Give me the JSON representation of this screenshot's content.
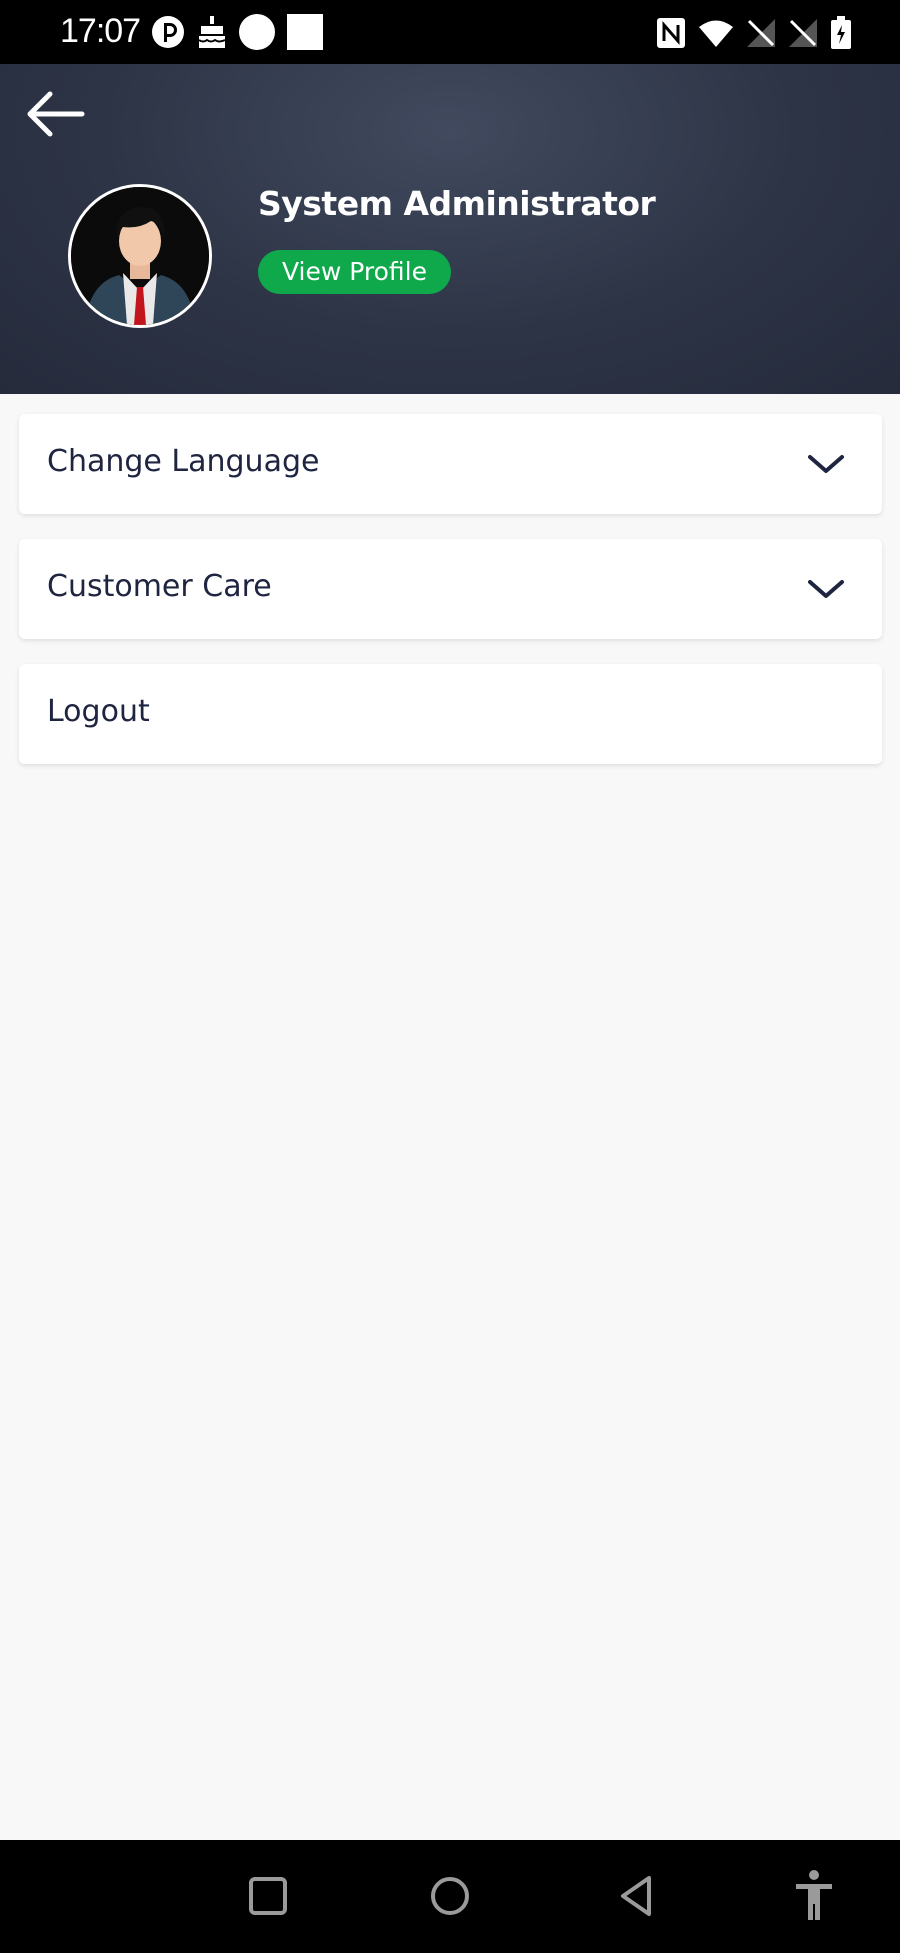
{
  "status_bar": {
    "time": "17:07",
    "left_icons": [
      "data-saver-icon",
      "cake-icon",
      "circle-icon",
      "square-icon"
    ],
    "right_icons": [
      "nfc-icon",
      "wifi-icon",
      "no-sim-icon",
      "no-sim-icon",
      "battery-icon"
    ]
  },
  "header": {
    "back_icon": "arrow-left-icon",
    "user_name": "System Administrator",
    "view_profile_label": "View Profile",
    "accent_color": "#0fa94b",
    "background_color": "#2d3446"
  },
  "menu": {
    "items": [
      {
        "label": "Change Language",
        "icon": "chevron-down-icon"
      },
      {
        "label": "Customer Care",
        "icon": "chevron-down-icon"
      },
      {
        "label": "Logout"
      }
    ]
  },
  "nav_bar": {
    "buttons": [
      "recents-icon",
      "home-icon",
      "back-icon",
      "accessibility-icon"
    ]
  }
}
